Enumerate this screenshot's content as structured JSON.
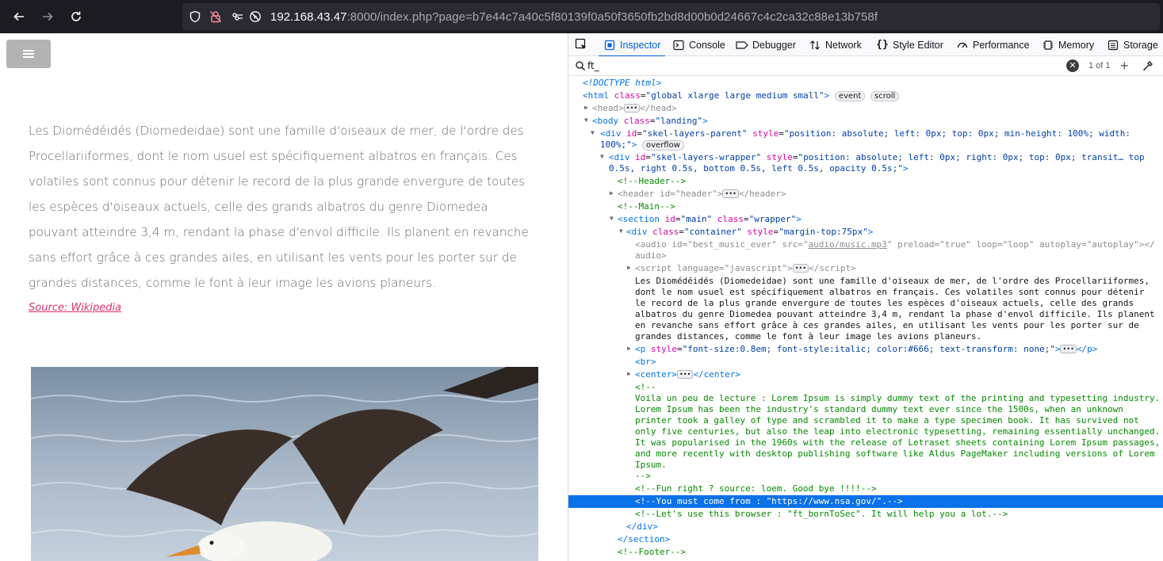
{
  "browser": {
    "url_host": "192.168.43.47",
    "url_rest": ":8000/index.php?page=b7e44c7a40c5f80139f0a50f3650fb2bd8d00b0d24667c4c2ca32c88e13b758f"
  },
  "page": {
    "menu_icon": "☰",
    "paragraph": "Les Diomédéidés (Diomedeidae) sont une famille d'oiseaux de mer, de l'ordre des Procellariiformes, dont le nom usuel est spécifiquement albatros en français. Ces volatiles sont connus pour détenir le record de la plus grande envergure de toutes les espèces d'oiseaux actuels, celle des grands albatros du genre Diomedea pouvant atteindre 3,4 m, rendant la phase d'envol difficile. Ils planent en revanche sans effort grâce à ces grandes ailes, en utilisant les vents pour les porter sur de grandes distances, comme le font à leur image les avions planeurs.",
    "source_link": "Source: Wikipedia"
  },
  "devtools": {
    "tabs": [
      {
        "label": "Inspector",
        "icon": "inspector-icon"
      },
      {
        "label": "Console",
        "icon": "console-icon"
      },
      {
        "label": "Debugger",
        "icon": "debugger-icon"
      },
      {
        "label": "Network",
        "icon": "network-icon"
      },
      {
        "label": "Style Editor",
        "icon": "style-editor-icon"
      },
      {
        "label": "Performance",
        "icon": "performance-icon"
      },
      {
        "label": "Memory",
        "icon": "memory-icon"
      },
      {
        "label": "Storage",
        "icon": "storage-icon"
      }
    ],
    "search": {
      "value": "ft_",
      "match_count": "1 of 1"
    },
    "tree": {
      "doctype": "<!DOCTYPE html>",
      "html_tag": "html",
      "html_class_attr": "class",
      "html_class_val": "global xlarge large medium small",
      "badge_event": "event",
      "badge_scroll": "scroll",
      "badge_overflow": "overflow",
      "head_open": "<head>",
      "head_close": "</head>",
      "body_tag": "body",
      "body_class_val": "landing",
      "skel_parent_id": "skel-layers-parent",
      "skel_parent_style": "position: absolute; left: 0px; top: 0px; min-height: 100%; width:",
      "skel_parent_style2": "100%;",
      "skel_wrapper_id": "skel-layers-wrapper",
      "skel_wrapper_style": "position: absolute; left: 0px; right: 0px; top: 0px; transit… top",
      "skel_wrapper_style2": "0.5s, right 0.5s, bottom 0.5s, left 0.5s, opacity 0.5s;",
      "comment_header": "<!--Header-->",
      "header_id": "header",
      "comment_main": "<!--Main-->",
      "section_id": "main",
      "section_class": "wrapper",
      "container_class": "container",
      "container_style": "margin-top:75px",
      "audio_id": "best_music_ever",
      "audio_src": "audio/music.mp3",
      "audio_preload": "true",
      "audio_loop": "loop",
      "audio_autoplay": "autoplay",
      "audio_close": "audio>",
      "script_lang": "javascript",
      "text_node": "Les Diomédéidés (Diomedeidae) sont une famille d'oiseaux de mer, de l'ordre des Procellariiformes, dont le nom usuel est spécifiquement albatros en français. Ces volatiles sont connus pour détenir le record de la plus grande envergure de toutes les espèces d'oiseaux actuels, celle des grands albatros du genre Diomedea pouvant atteindre 3,4 m, rendant la phase d'envol difficile. Ils planent en revanche sans effort grâce à ces grandes ailes, en utilisant les vents pour les porter sur de grandes distances, comme le font à leur image les avions planeurs.",
      "p_style": "font-size:0.8em; font-style:italic; color:#666; text-transform: none;",
      "br": "<br>",
      "comment_open": "<!--",
      "lorem_comment": "Voila un peu de lecture : Lorem Ipsum is simply dummy text of the printing and typesetting industry. Lorem Ipsum has been the industry's standard dummy text ever since the 1500s, when an unknown printer took a galley of type and scrambled it to make a type specimen book. It has survived not only five centuries, but also the leap into electronic typesetting, remaining essentially unchanged. It was popularised in the 1960s with the release of Letraset sheets containing Lorem Ipsum passages, and more recently with desktop publishing software like Aldus PageMaker including versions of Lorem Ipsum.",
      "comment_close": "-->",
      "comment_fun": "<!--Fun right ? source: loem. Good bye !!!!-->",
      "comment_nsa": "<!--You must come from : \"https://www.nsa.gov/\".-->",
      "comment_browser": "<!--Let's use this browser : \"ft_bornToSec\". It will help you a lot.-->",
      "div_close": "</div>",
      "section_close": "</section>",
      "comment_footer": "<!--Footer-->"
    }
  }
}
